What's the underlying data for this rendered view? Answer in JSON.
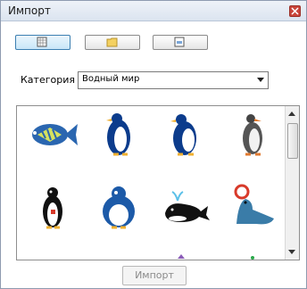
{
  "window": {
    "title": "Импорт"
  },
  "toolbar": {
    "buttons": [
      "grid-view-icon",
      "folder-icon",
      "image-icon"
    ]
  },
  "category": {
    "label": "Категория",
    "selected": "Водный мир"
  },
  "gallery": {
    "items": [
      "fish",
      "penguin-1",
      "penguin-2",
      "penguin-3",
      "penguin-4",
      "penguin-5",
      "whale",
      "seal"
    ]
  },
  "footer": {
    "import_label": "Импорт"
  }
}
